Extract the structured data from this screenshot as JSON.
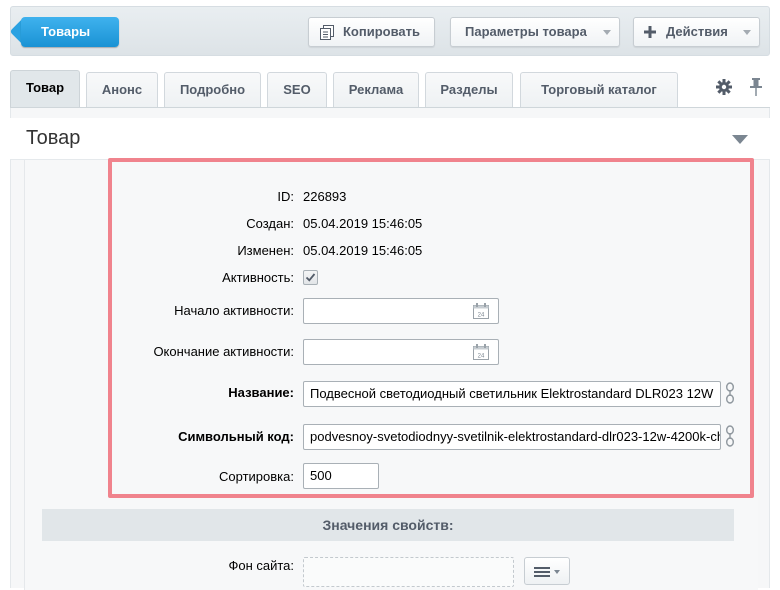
{
  "toolbar": {
    "back_label": "Товары",
    "copy_label": "Копировать",
    "params_label": "Параметры товара",
    "actions_label": "Действия"
  },
  "tabs": [
    {
      "label": "Товар",
      "active": true
    },
    {
      "label": "Анонс"
    },
    {
      "label": "Подробно"
    },
    {
      "label": "SEO"
    },
    {
      "label": "Реклама"
    },
    {
      "label": "Разделы"
    },
    {
      "label": "Торговый каталог"
    }
  ],
  "panel": {
    "title": "Товар"
  },
  "form": {
    "id_label": "ID:",
    "id_value": "226893",
    "created_label": "Создан:",
    "created_value": "05.04.2019 15:46:05",
    "modified_label": "Изменен:",
    "modified_value": "05.04.2019 15:46:05",
    "active_label": "Активность:",
    "active_checked": true,
    "active_from_label": "Начало активности:",
    "active_from_value": "",
    "active_to_label": "Окончание активности:",
    "active_to_value": "",
    "name_label": "Название:",
    "name_value": "Подвесной светодиодный светильник Elektrostandard DLR023 12W",
    "code_label": "Символьный код:",
    "code_value": "podvesnoy-svetodiodnyy-svetilnik-elektrostandard-dlr023-12w-4200k-ch",
    "sort_label": "Сортировка:",
    "sort_value": "500"
  },
  "properties": {
    "section_label": "Значения свойств:",
    "site_bg_label": "Фон сайта:"
  },
  "colors": {
    "accent": "#1a92d4",
    "highlight": "#f0838d"
  }
}
